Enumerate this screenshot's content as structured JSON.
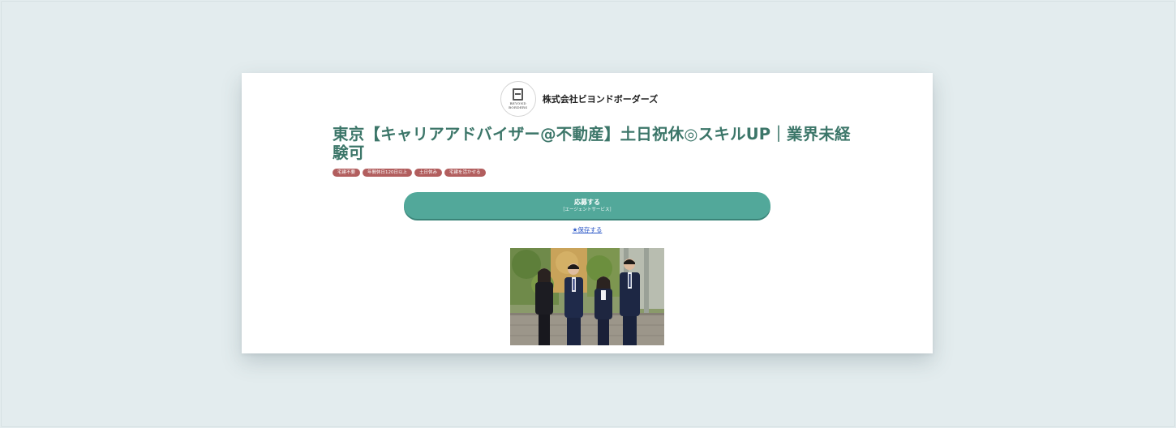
{
  "company": {
    "logo_text": [
      "BEYOND",
      "BORDERS"
    ],
    "name": "株式会社ビヨンドボーダーズ"
  },
  "job": {
    "title": "東京【キャリアアドバイザー@不動産】土日祝休◎スキルUP｜業界未経験可",
    "tags": [
      "宅建不要",
      "年間休日120日以上",
      "土日休み",
      "宅建を活かせる"
    ]
  },
  "actions": {
    "apply_label": "応募する",
    "apply_sub": "［エージェントサービス］",
    "save_label": "★保存する"
  },
  "colors": {
    "title": "#3c7669",
    "tag": "#b25e5e",
    "apply": "#52a89a",
    "link": "#2a56c6",
    "background": "#e3ecee"
  }
}
